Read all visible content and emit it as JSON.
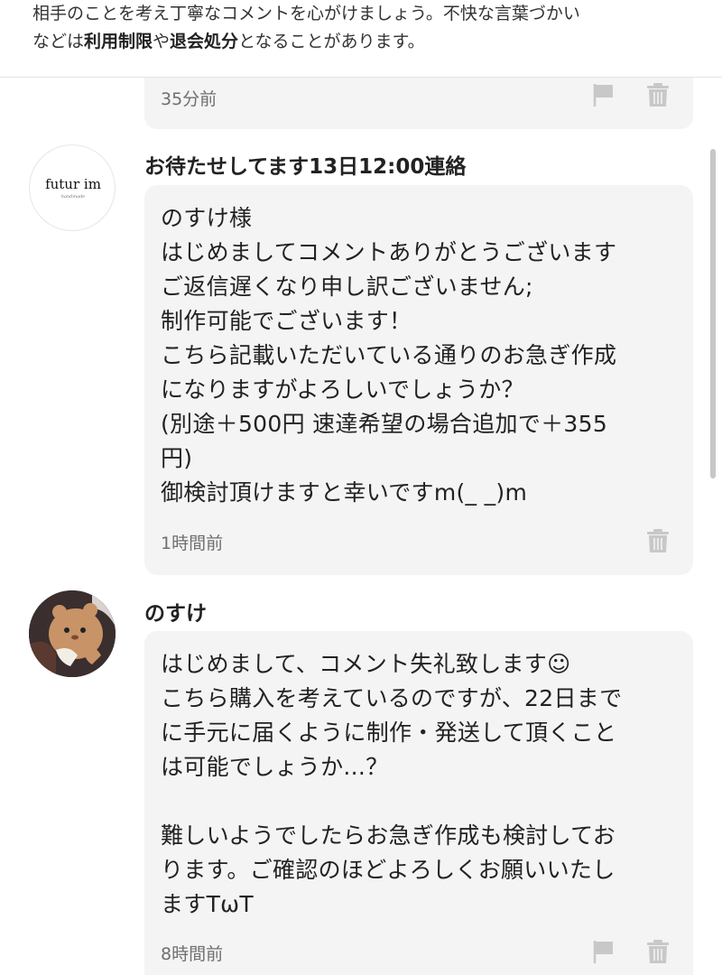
{
  "notice": {
    "part1": "相手のことを考え丁寧なコメントを心がけましょう。不快な言葉づかい",
    "part2": "などは",
    "bold1": "利用制限",
    "part3": "や",
    "bold2": "退会処分",
    "part4": "となることがあります。"
  },
  "comments": [
    {
      "time": "35分前"
    },
    {
      "name": "お待たせしてます13日12:00連絡",
      "avatar_text": "futur im",
      "avatar_sub": "handmade",
      "body": "のすけ様\nはじめましてコメントありがとうございます\nご返信遅くなり申し訳ございません;\n制作可能でございます！\nこちら記載いただいている通りのお急ぎ作成\nになりますがよろしいでしょうか？\n(別途＋500円 速達希望の場合追加で＋355\n円)\n御検討頂けますと幸いですm(_ _)m",
      "time": "1時間前"
    },
    {
      "name": "のすけ",
      "body": "はじめまして、コメント失礼致します☺\nこちら購入を考えているのですが、22日まで\nに手元に届くように制作・発送して頂くこと\nは可能でしょうか...？\n\n難しいようでしたらお急ぎ作成も検討してお\nります。ご確認のほどよろしくお願いいたし\nますTωT",
      "time": "8時間前"
    }
  ],
  "colors": {
    "bubble": "#f4f4f4",
    "icon": "#c8c8c8",
    "meta": "#6f6f6f"
  }
}
